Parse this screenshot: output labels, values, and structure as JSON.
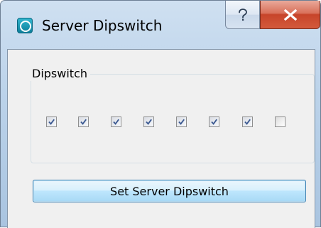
{
  "window": {
    "title": "Server Dipswitch",
    "icon": "app-logo-icon",
    "help_glyph": "?",
    "close_glyph": "X"
  },
  "group": {
    "label": "Dipswitch"
  },
  "switches": [
    {
      "checked": true
    },
    {
      "checked": true
    },
    {
      "checked": true
    },
    {
      "checked": true
    },
    {
      "checked": true
    },
    {
      "checked": true
    },
    {
      "checked": true
    },
    {
      "checked": false
    }
  ],
  "button": {
    "label": "Set Server Dipswitch"
  },
  "colors": {
    "titlebar": "#bcd3ea",
    "close_button": "#c7442a",
    "client_bg": "#f0f0f0",
    "check_mark": "#3d5a92",
    "button_accent": "#3c7fb1"
  }
}
